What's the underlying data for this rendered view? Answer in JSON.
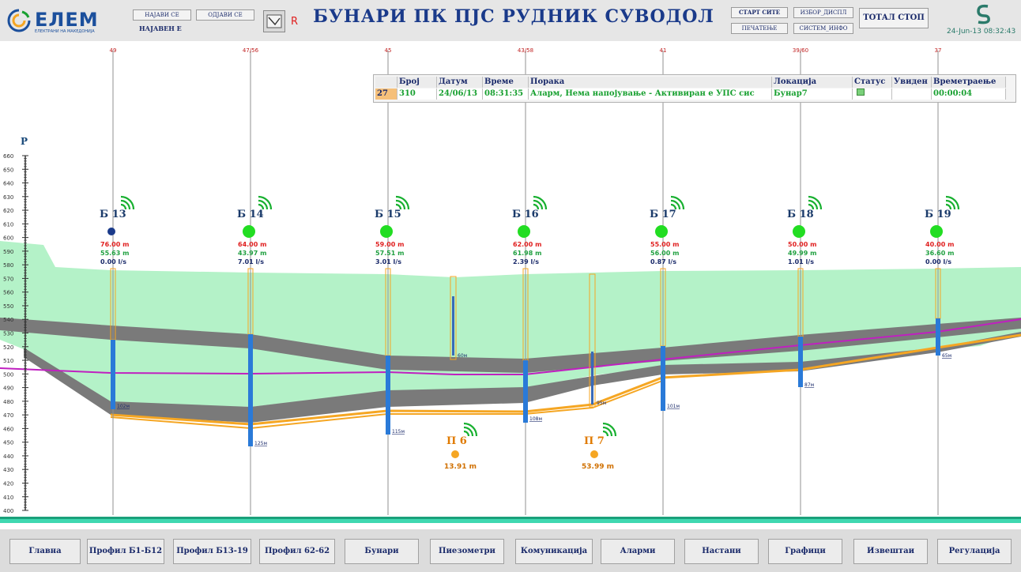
{
  "header": {
    "logo_text": "ЕЛЕМ",
    "logo_sub": "ЕЛЕКТРАНИ НА МАКЕДОНИЈА",
    "login_label": "НАЈАВИ СЕ",
    "logout_label": "ОДЈАВИ СЕ",
    "logged_status": "НАЈАВЕН Е",
    "r_mark": "R",
    "title": "БУНАРИ ПК ПЈС РУДНИК СУВОДОЛ",
    "start_all_label": "СТАРТ СИТЕ",
    "print_label": "ПЕЧАТЕЊЕ",
    "display_select_label": "ИЗБОР_ДИСПЛ",
    "system_info_label": "СИСТЕМ_ИНФО",
    "total_stop_label": "ТОТАЛ СТОП",
    "datetime": "24-Jun-13 08:32:43"
  },
  "alarm_table": {
    "headers": [
      "",
      "Број",
      "Датум",
      "Време",
      "Порака",
      "Локација",
      "Статус",
      "Увиден",
      "Времетраење"
    ],
    "row": [
      "27",
      "310",
      "24/06/13",
      "08:31:35",
      "Аларм, Нема напојување - Активиран е УПС сис",
      "Бунар7",
      "",
      "",
      "00:00:04"
    ]
  },
  "axis": {
    "label": "P",
    "ticks": [
      "660",
      "650",
      "640",
      "630",
      "620",
      "610",
      "600",
      "590",
      "580",
      "570",
      "560",
      "550",
      "540",
      "530",
      "520",
      "510",
      "500",
      "490",
      "480",
      "470",
      "460",
      "450",
      "440",
      "430",
      "420",
      "410",
      "400"
    ]
  },
  "markers": [
    "49",
    "47/56",
    "45",
    "43/58",
    "41",
    "39/60",
    "37"
  ],
  "wells": [
    {
      "name": "Б 13",
      "status": "blue",
      "v1": "76.00",
      "v2": "55.63",
      "v3": "0.00",
      "u1": "m",
      "u2": "m",
      "u3": "l/s",
      "depth": "102м"
    },
    {
      "name": "Б 14",
      "status": "green",
      "v1": "64.00",
      "v2": "43.97",
      "v3": "7.01",
      "u1": "m",
      "u2": "m",
      "u3": "l/s",
      "depth": "125м"
    },
    {
      "name": "Б 15",
      "status": "green",
      "v1": "59.00",
      "v2": "57.51",
      "v3": "3.01",
      "u1": "m",
      "u2": "m",
      "u3": "l/s",
      "depth": "115м"
    },
    {
      "name": "Б 16",
      "status": "green",
      "v1": "62.00",
      "v2": "61.98",
      "v3": "2.39",
      "u1": "m",
      "u2": "m",
      "u3": "l/s",
      "depth": "108м"
    },
    {
      "name": "Б 17",
      "status": "green",
      "v1": "55.00",
      "v2": "56.00",
      "v3": "0.87",
      "u1": "m",
      "u2": "m",
      "u3": "l/s",
      "depth": "101м"
    },
    {
      "name": "Б 18",
      "status": "green",
      "v1": "50.00",
      "v2": "49.99",
      "v3": "1.01",
      "u1": "m",
      "u2": "m",
      "u3": "l/s",
      "depth": "87м"
    },
    {
      "name": "Б 19",
      "status": "green",
      "v1": "40.00",
      "v2": "36.60",
      "v3": "0.00",
      "u1": "m",
      "u2": "m",
      "u3": "l/s",
      "depth": "65м"
    }
  ],
  "piezometers": [
    {
      "name": "П 6",
      "value": "13.91",
      "unit": "m",
      "depth": "60м"
    },
    {
      "name": "П 7",
      "value": "53.99",
      "unit": "m",
      "depth": "95м"
    }
  ],
  "nav": [
    "Главна",
    "Профил Б1-Б12",
    "Профил Б13-19",
    "Профил 62-62",
    "Бунари",
    "Пиезометри",
    "Комуникација",
    "Аларми",
    "Настани",
    "Графици",
    "Извештаи",
    "Регулација"
  ],
  "colors": {
    "status_green": "#22dd22",
    "status_blue": "#1a3a8a",
    "aquifer": "#b4f2c8",
    "clay": "#7a7a7a",
    "sand": "#f5a623",
    "water_line": "#c020c0",
    "well_pipe": "#2a7ad8",
    "bottom_bar": "#1aa07a"
  }
}
